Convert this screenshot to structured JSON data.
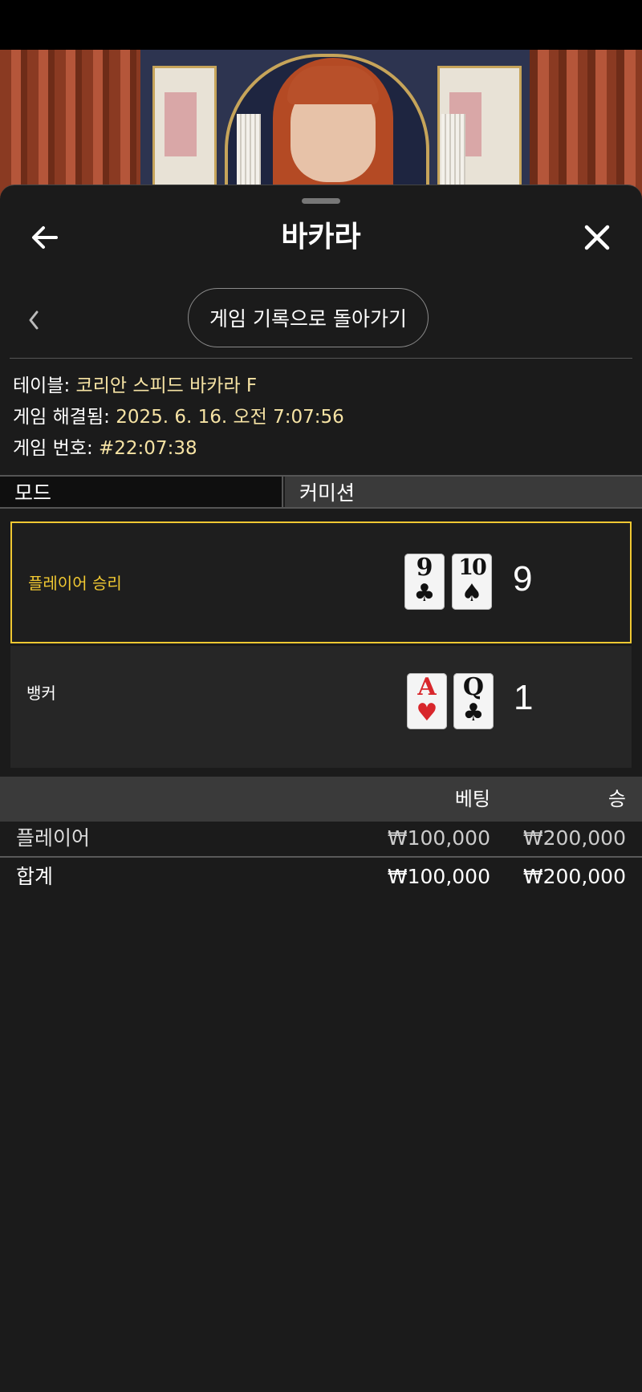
{
  "header": {
    "title": "바카라"
  },
  "nav": {
    "history_button": "게임 기록으로 돌아가기"
  },
  "info": {
    "table_label": "테이블:",
    "table_value": "코리안 스피드 바카라 F",
    "resolved_label": "게임 해결됨:",
    "resolved_value": "2025. 6. 16. 오전 7:07:56",
    "number_label": "게임 번호:",
    "number_value": "#22:07:38"
  },
  "mode": {
    "left": "모드",
    "right": "커미션"
  },
  "results": {
    "player": {
      "label": "플레이어 승리",
      "score": "9",
      "cards": [
        {
          "rank": "9",
          "suit": "♣",
          "color": "black"
        },
        {
          "rank": "10",
          "suit": "♠",
          "color": "black"
        }
      ]
    },
    "banker": {
      "label": "뱅커",
      "score": "1",
      "cards": [
        {
          "rank": "A",
          "suit": "♥",
          "color": "red"
        },
        {
          "rank": "Q",
          "suit": "♣",
          "color": "black"
        }
      ]
    }
  },
  "bets": {
    "columns": {
      "bet": "베팅",
      "win": "승"
    },
    "rows": [
      {
        "name": "플레이어",
        "bet": "₩100,000",
        "win": "₩200,000"
      }
    ],
    "total": {
      "name": "합계",
      "bet": "₩100,000",
      "win": "₩200,000"
    }
  },
  "colors": {
    "accent": "#f0c832",
    "info_value": "#f6e3a4",
    "sheet_bg": "#1b1b1b"
  }
}
